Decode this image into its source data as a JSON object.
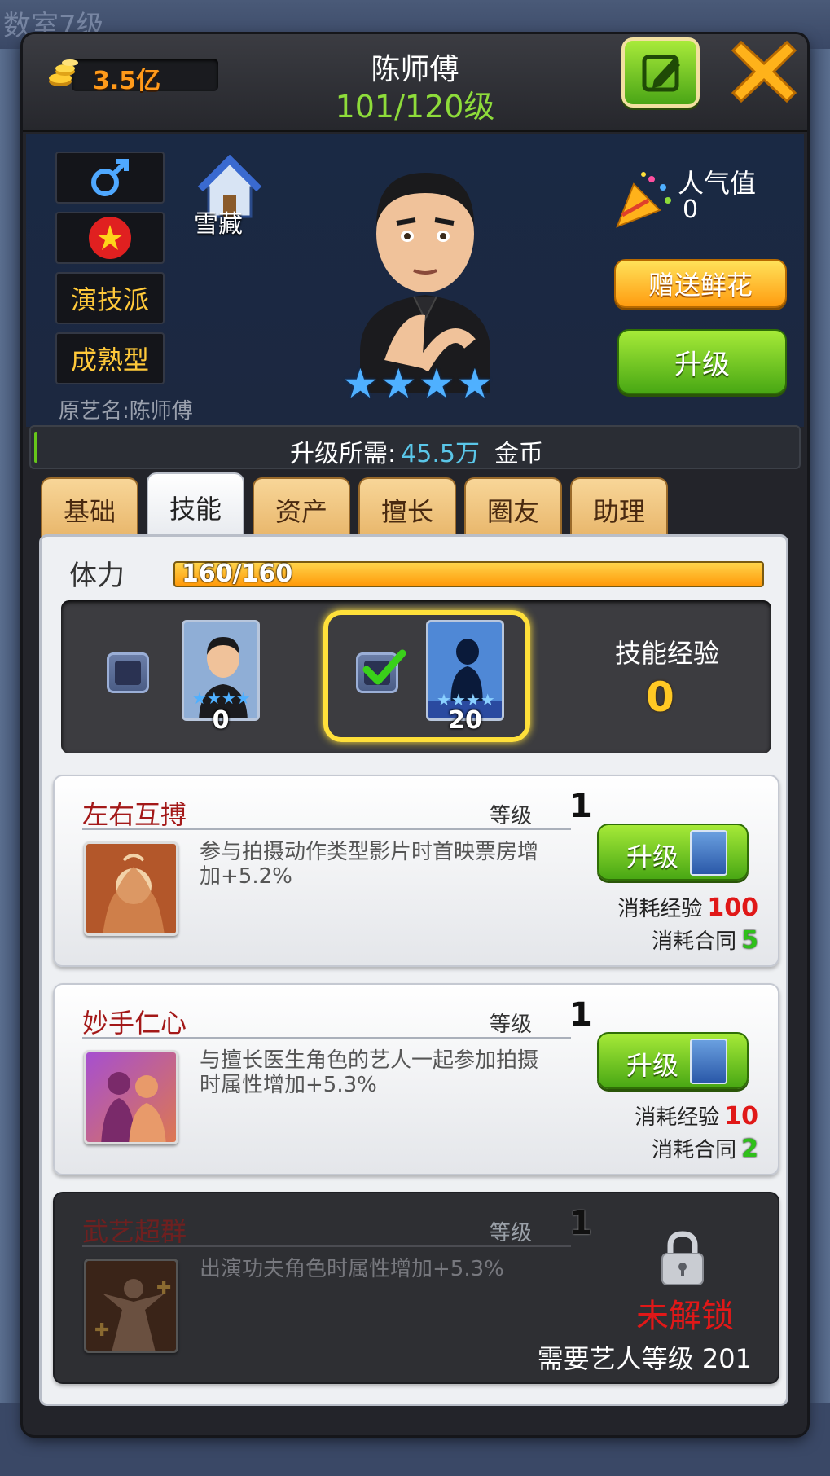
{
  "background": {
    "title_fragment": "数室7级"
  },
  "header": {
    "gold": "3.5亿",
    "actor_name": "陈师傅",
    "level": "101/120级"
  },
  "profile": {
    "attributes": [
      "演技派",
      "成熟型"
    ],
    "original_name": "原艺名:陈师傅",
    "agency": "雪藏",
    "star_count": 4,
    "popularity_label": "人气值",
    "popularity_value": "0",
    "gift_button": "赠送鲜花",
    "upgrade_button": "升级"
  },
  "upgrade_requirement": {
    "label": "升级所需:",
    "value": "45.5万",
    "unit": "金币"
  },
  "tabs": [
    {
      "label": "基础",
      "active": false
    },
    {
      "label": "技能",
      "active": true
    },
    {
      "label": "资产",
      "active": false
    },
    {
      "label": "擅长",
      "active": false
    },
    {
      "label": "圈友",
      "active": false
    },
    {
      "label": "助理",
      "active": false
    }
  ],
  "stamina": {
    "label": "体力",
    "value": "160/160",
    "fraction": 1.0
  },
  "skill_cards": {
    "card1": {
      "count": "0",
      "checked": false
    },
    "card2": {
      "count": "20",
      "checked": true
    },
    "exp_label": "技能经验",
    "exp_value": "0"
  },
  "skills": [
    {
      "name": "左右互搏",
      "level_label": "等级",
      "level": "1",
      "description": "参与拍摄动作类型影片时首映票房增加+5.2%",
      "upgrade_label": "升级",
      "cost_exp_label": "消耗经验",
      "cost_exp": "100",
      "cost_contract_label": "消耗合同",
      "cost_contract": "5"
    },
    {
      "name": "妙手仁心",
      "level_label": "等级",
      "level": "1",
      "description": "与擅长医生角色的艺人一起参加拍摄时属性增加+5.3%",
      "upgrade_label": "升级",
      "cost_exp_label": "消耗经验",
      "cost_exp": "10",
      "cost_contract_label": "消耗合同",
      "cost_contract": "2"
    },
    {
      "name": "武艺超群",
      "level_label": "等级",
      "level": "1",
      "description": "出演功夫角色时属性增加+5.3%",
      "locked_label": "未解锁",
      "requirement": "需要艺人等级 201"
    }
  ],
  "colors": {
    "accent_green": "#8edc3a",
    "gold": "#ff9a1a",
    "star_blue": "#4fb0ff",
    "highlight_yellow": "#ffe03a",
    "cost_red": "#e01818"
  }
}
